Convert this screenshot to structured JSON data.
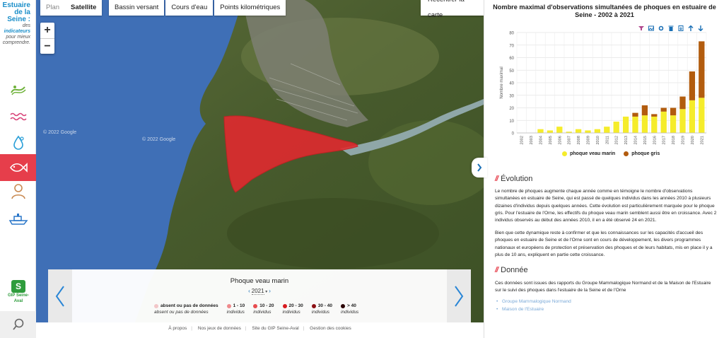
{
  "brand": {
    "line1": "Estuaire",
    "line2": "de la",
    "line3": "Seine :",
    "tag_prefix": "des",
    "tag_bold": "indicateurs",
    "tag_rest": "pour mieux comprendre."
  },
  "sidebar": {
    "items": [
      {
        "name": "eau",
        "icon": "stream-icon"
      },
      {
        "name": "vagues",
        "icon": "waves-icon"
      },
      {
        "name": "goutte",
        "icon": "drop-icon"
      },
      {
        "name": "poisson",
        "icon": "fish-icon",
        "active": true
      },
      {
        "name": "humain",
        "icon": "person-icon"
      },
      {
        "name": "bateau",
        "icon": "ship-icon"
      }
    ],
    "logo_text": "GIP Seine-Aval",
    "logo_mark": "S"
  },
  "map": {
    "base_layers": [
      "Plan",
      "Satellite"
    ],
    "active_base": "Satellite",
    "overlays": [
      "Bassin versant",
      "Cours d'eau",
      "Points kilométriques"
    ],
    "recenter_label": "Recentrer la carte",
    "zoom_in": "+",
    "zoom_out": "−",
    "watermark": "© 2022 Google",
    "colors": {
      "sea": "#3f6fb6",
      "land": "#4a5e2e",
      "zone": "#e02a2f",
      "river": "#8fa7a8"
    }
  },
  "legend": {
    "title": "Phoque veau marin",
    "year": "2021",
    "items": [
      {
        "label": "absent ou pas de données",
        "sub": "absent ou pas de données",
        "color": "#f2c6c8"
      },
      {
        "label": "1 - 10",
        "sub": "individus",
        "color": "#ee8a8c"
      },
      {
        "label": "10 - 20",
        "sub": "individus",
        "color": "#e74c4f"
      },
      {
        "label": "20 - 30",
        "sub": "individus",
        "color": "#d71b1f"
      },
      {
        "label": "30 - 40",
        "sub": "individus",
        "color": "#8c1014"
      },
      {
        "label": "> 40",
        "sub": "individus",
        "color": "#2a0405"
      }
    ]
  },
  "footer": {
    "links": [
      "À propos",
      "Nos jeux de données",
      "Site du GIP Seine-Aval",
      "Gestion des cookies"
    ]
  },
  "chart_data": {
    "type": "bar",
    "title": "Nombre maximal d'observations simultanées de phoques en estuaire de Seine - 2002 à 2021",
    "ylabel": "Nombre maximal",
    "xlabel": "",
    "ylim": [
      0,
      80
    ],
    "yticks": [
      0,
      10,
      20,
      30,
      40,
      50,
      60,
      70,
      80
    ],
    "stacked": true,
    "grid": true,
    "legend_position": "bottom",
    "categories": [
      "2002",
      "2003",
      "2004",
      "2005",
      "2006",
      "2007",
      "2008",
      "2009",
      "2010",
      "2011",
      "2012",
      "2013",
      "2014",
      "2015",
      "2016",
      "2017",
      "2018",
      "2019",
      "2020",
      "2021"
    ],
    "series": [
      {
        "name": "phoque veau marin",
        "color": "#f5ec2b",
        "values": [
          0,
          0,
          3,
          2,
          5,
          1,
          3,
          2,
          3,
          5,
          9,
          13,
          13,
          14,
          13,
          17,
          14,
          19,
          26,
          28
        ]
      },
      {
        "name": "phoque gris",
        "color": "#b25c0e",
        "values": [
          0,
          0,
          0,
          0,
          0,
          0,
          0,
          0,
          0,
          0,
          0,
          0,
          3,
          8,
          2,
          3,
          6,
          10,
          23,
          45
        ]
      }
    ]
  },
  "panel": {
    "tools": [
      "filter-icon",
      "image-icon",
      "settings-icon",
      "trash-icon",
      "download-icon",
      "arrow-up-icon",
      "arrow-down-icon"
    ],
    "evolution_title": "Évolution",
    "evolution_p1": "Le nombre de phoques augmente chaque année comme en témoigne le nombre d'observations simultanées en estuaire de Seine, qui est passé de quelques individus dans les années 2010 à plusieurs dizaines d'individus depuis quelques années. Cette évolution est particulièrement marquée pour le phoque gris. Pour l'estuaire de l'Orne, les effectifs du phoque veau marin semblent aussi être en croissance. Avec 2 individus observés au début des années 2010, il en a été observé 24 en 2021.",
    "evolution_p2": "Bien que cette dynamique reste à confirmer et que les connaissances sur les capacités d'accueil des phoques en estuaire de Seine et de l'Orne sont en cours de développement, les divers programmes nationaux et européens de protection et préservation des phoques et de leurs habitats, mis en place il y a plus de 10 ans, expliquent en partie cette croissance.",
    "donnee_title": "Donnée",
    "donnee_p": "Ces données sont issues des rapports du Groupe Mammalogique Normand et de la Maison de l'Estuaire sur le suivi des phoques dans l'estuaire de la Seine et de l'Orne",
    "links": [
      "Groupe Mammalogique Normand",
      "Maison de l'Estuaire"
    ]
  }
}
